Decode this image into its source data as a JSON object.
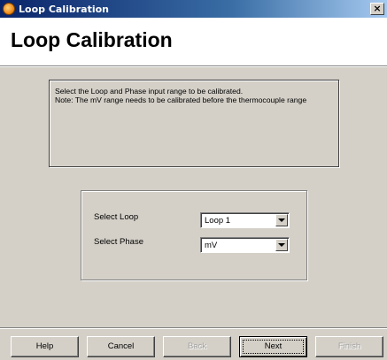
{
  "window": {
    "title": "Loop Calibration",
    "close_symbol": "×"
  },
  "header": {
    "heading": "Loop Calibration"
  },
  "instructions": {
    "line1": "Select the Loop and Phase input range to be calibrated.",
    "line2": "Note: The mV range needs to be calibrated before the thermocouple range"
  },
  "form": {
    "loop_label": "Select Loop",
    "loop_value": "Loop 1",
    "phase_label": "Select Phase",
    "phase_value": "mV"
  },
  "buttons": {
    "help": "Help",
    "cancel": "Cancel",
    "back": "Back",
    "next": "Next",
    "finish": "Finish"
  },
  "colors": {
    "face": "#d4d0c8",
    "title_bar_start": "#0a246a",
    "title_bar_end": "#a6caf0",
    "header_bg": "#ffffff"
  }
}
